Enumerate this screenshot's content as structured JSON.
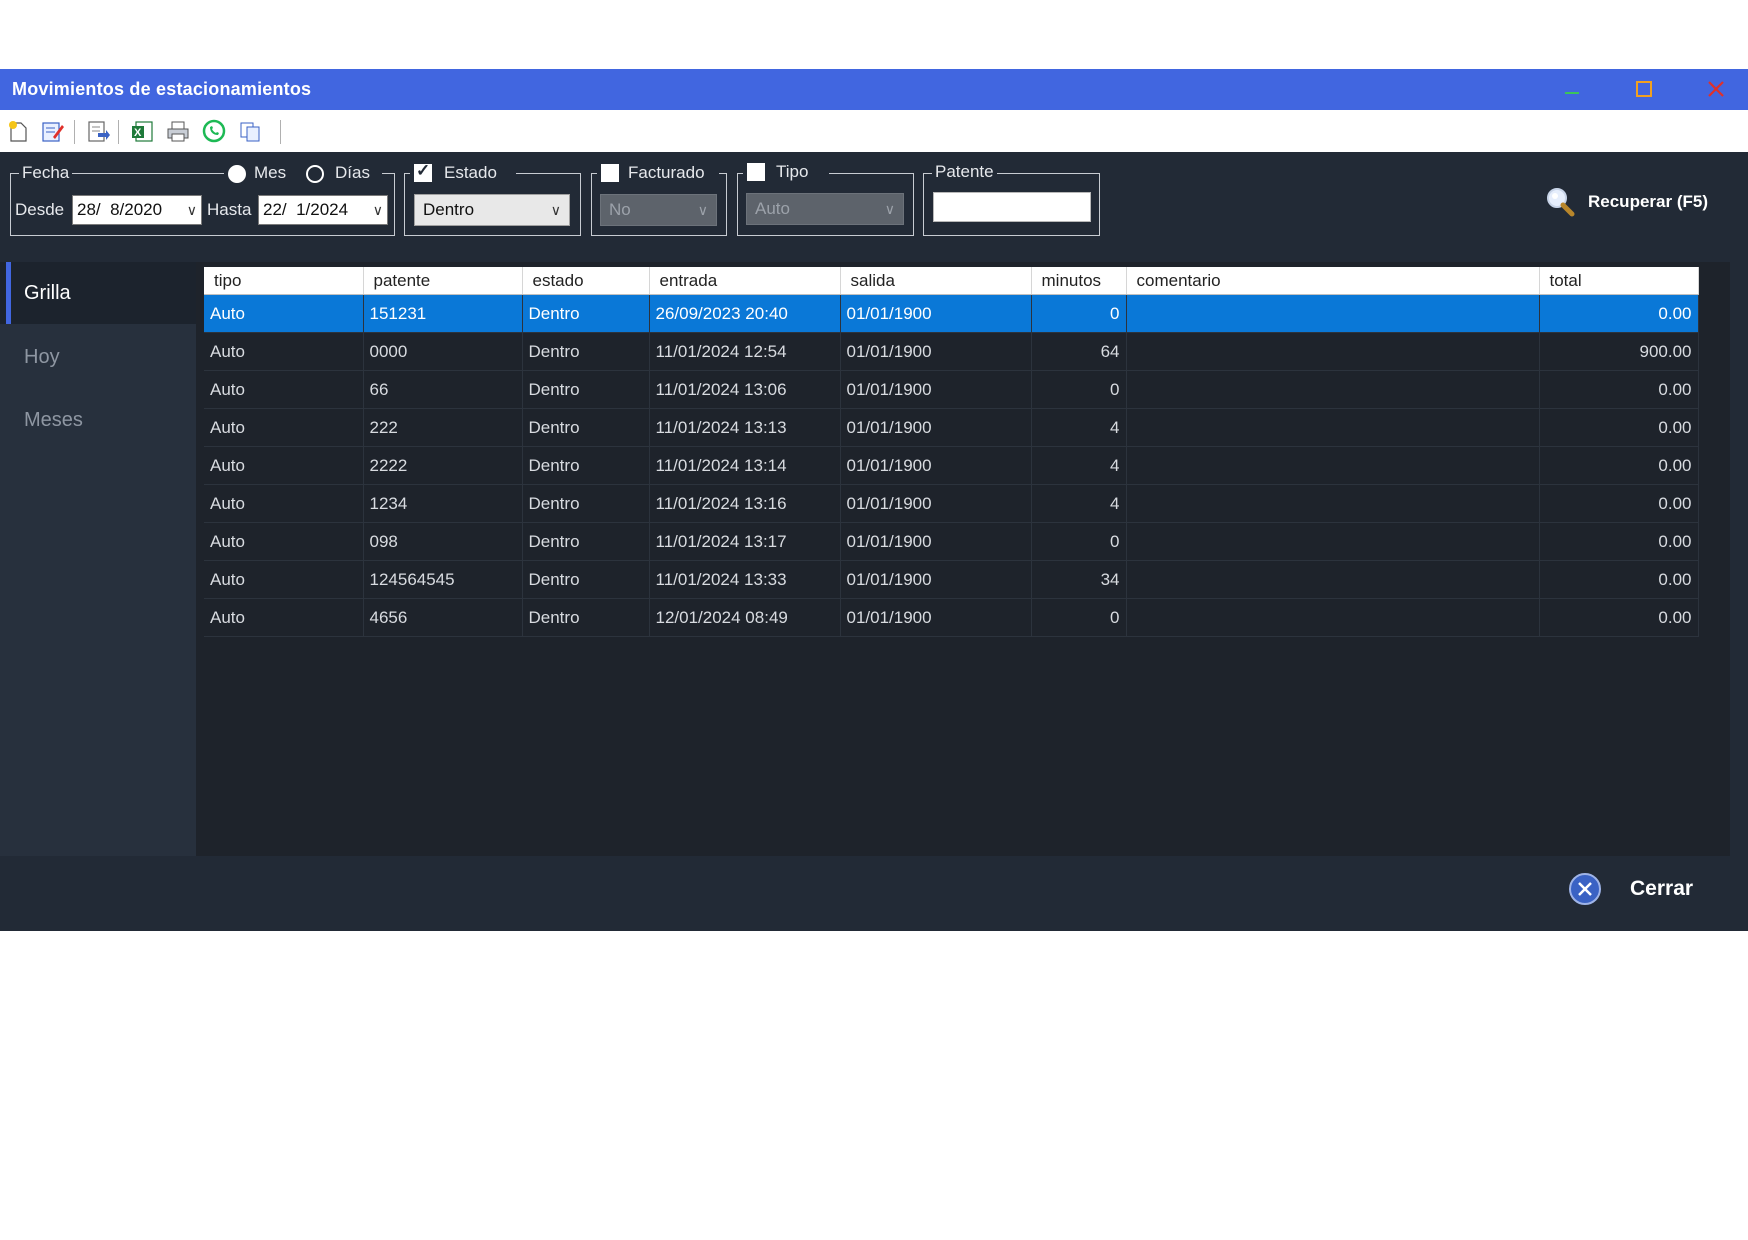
{
  "window": {
    "title": "Movimientos de estacionamientos"
  },
  "toolbar": {
    "icons": [
      "new-document-icon",
      "edit-document-icon",
      "export-icon",
      "excel-icon",
      "print-icon",
      "whatsapp-icon",
      "copy-icon"
    ]
  },
  "filters": {
    "fecha": {
      "label": "Fecha",
      "mes_label": "Mes",
      "dias_label": "Días",
      "mes_selected": true,
      "desde_label": "Desde",
      "desde_value": "28/  8/2020",
      "hasta_label": "Hasta",
      "hasta_value": "22/  1/2024"
    },
    "estado": {
      "label": "Estado",
      "checked": true,
      "value": "Dentro"
    },
    "facturado": {
      "label": "Facturado",
      "checked": false,
      "value": "No"
    },
    "tipo": {
      "label": "Tipo",
      "checked": false,
      "value": "Auto"
    },
    "patente": {
      "label": "Patente",
      "value": ""
    },
    "recuperar_label": "Recuperar (F5)"
  },
  "sidebar": {
    "items": [
      {
        "label": "Grilla",
        "active": true
      },
      {
        "label": "Hoy",
        "active": false
      },
      {
        "label": "Meses",
        "active": false
      }
    ]
  },
  "grid": {
    "columns": [
      "tipo",
      "patente",
      "estado",
      "entrada",
      "salida",
      "minutos",
      "comentario",
      "total"
    ],
    "rows": [
      [
        "Auto",
        "151231",
        "Dentro",
        "26/09/2023 20:40",
        "01/01/1900",
        "0",
        "",
        "0.00"
      ],
      [
        "Auto",
        "0000",
        "Dentro",
        "11/01/2024 12:54",
        "01/01/1900",
        "64",
        "",
        "900.00"
      ],
      [
        "Auto",
        "66",
        "Dentro",
        "11/01/2024 13:06",
        "01/01/1900",
        "0",
        "",
        "0.00"
      ],
      [
        "Auto",
        "222",
        "Dentro",
        "11/01/2024 13:13",
        "01/01/1900",
        "4",
        "",
        "0.00"
      ],
      [
        "Auto",
        "2222",
        "Dentro",
        "11/01/2024 13:14",
        "01/01/1900",
        "4",
        "",
        "0.00"
      ],
      [
        "Auto",
        "1234",
        "Dentro",
        "11/01/2024 13:16",
        "01/01/1900",
        "4",
        "",
        "0.00"
      ],
      [
        "Auto",
        "098",
        "Dentro",
        "11/01/2024 13:17",
        "01/01/1900",
        "0",
        "",
        "0.00"
      ],
      [
        "Auto",
        "124564545",
        "Dentro",
        "11/01/2024 13:33",
        "01/01/1900",
        "34",
        "",
        "0.00"
      ],
      [
        "Auto",
        "4656",
        "Dentro",
        "12/01/2024 08:49",
        "01/01/1900",
        "0",
        "",
        "0.00"
      ]
    ],
    "selected_row": 0
  },
  "footer": {
    "cerrar_label": "Cerrar"
  },
  "colors": {
    "titlebar": "#4166e0",
    "background": "#222a36",
    "grid_bg": "#1e232b",
    "selection": "#0a78d7",
    "minimize": "#3cc35a",
    "maximize": "#f0a020",
    "close": "#e0302a"
  }
}
